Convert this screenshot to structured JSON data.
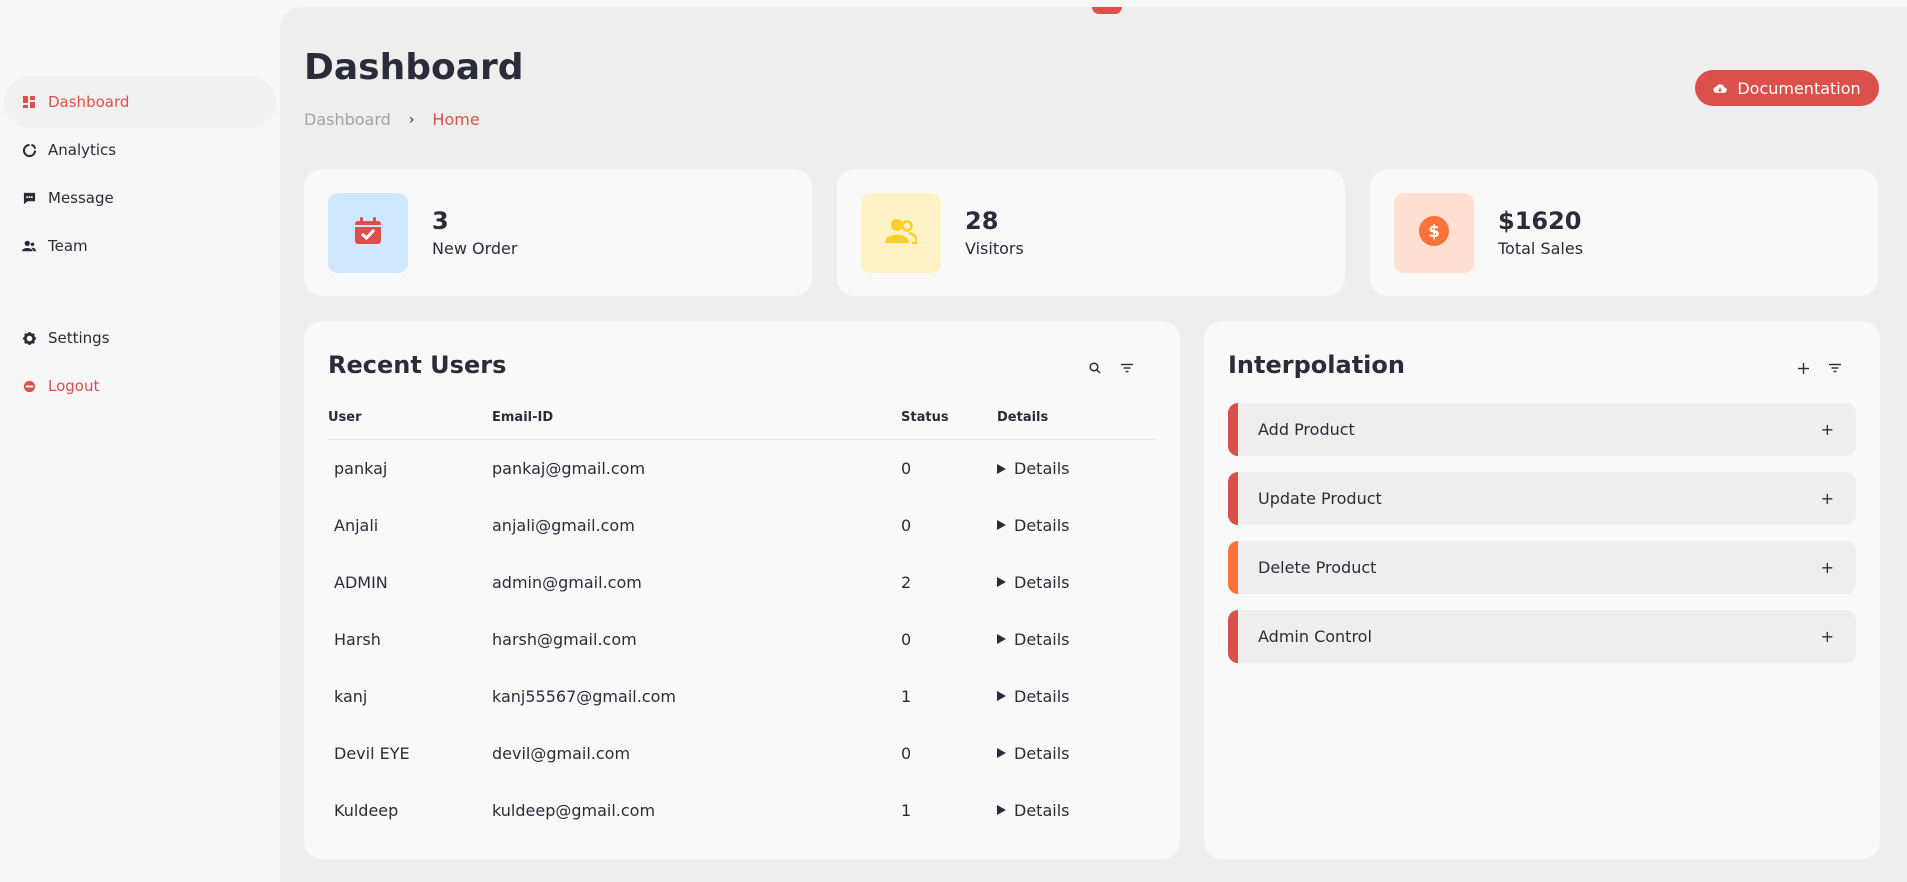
{
  "sidebar": {
    "items": [
      {
        "label": "Dashboard",
        "icon": "dashboard-icon",
        "active": true
      },
      {
        "label": "Analytics",
        "icon": "pie-chart-icon"
      },
      {
        "label": "Message",
        "icon": "message-icon"
      },
      {
        "label": "Team",
        "icon": "team-icon"
      },
      {
        "label": "Settings",
        "icon": "gear-icon"
      },
      {
        "label": "Logout",
        "icon": "logout-icon"
      }
    ]
  },
  "header": {
    "title": "Dashboard",
    "breadcrumb": [
      "Dashboard",
      "Home"
    ],
    "separator": "›",
    "doc_button": "Documentation"
  },
  "stats": [
    {
      "value": "3",
      "label": "New Order",
      "icon": "calendar-check-icon",
      "bg": "#cfe8ff",
      "fg": "#db504a"
    },
    {
      "value": "28",
      "label": "Visitors",
      "icon": "group-icon",
      "bg": "#fff2c6",
      "fg": "#ffce26"
    },
    {
      "value": "$1620",
      "label": "Total Sales",
      "icon": "dollar-circle-icon",
      "bg": "#ffe0d3",
      "fg": "#fd7238"
    }
  ],
  "recent_users": {
    "title": "Recent Users",
    "columns": [
      "User",
      "Email-ID",
      "Status",
      "Details"
    ],
    "details_label": "Details",
    "rows": [
      {
        "user": "pankaj",
        "email": "pankaj@gmail.com",
        "status": "0"
      },
      {
        "user": "Anjali",
        "email": "anjali@gmail.com",
        "status": "0"
      },
      {
        "user": "ADMIN",
        "email": "admin@gmail.com",
        "status": "2"
      },
      {
        "user": "Harsh",
        "email": "harsh@gmail.com",
        "status": "0"
      },
      {
        "user": "kanj",
        "email": "kanj55567@gmail.com",
        "status": "1"
      },
      {
        "user": "Devil EYE",
        "email": "devil@gmail.com",
        "status": "0"
      },
      {
        "user": "Kuldeep",
        "email": "kuldeep@gmail.com",
        "status": "1"
      }
    ]
  },
  "interpolation": {
    "title": "Interpolation",
    "plus": "+",
    "items": [
      {
        "label": "Add Product",
        "color": "#db504a"
      },
      {
        "label": "Update Product",
        "color": "#db504a"
      },
      {
        "label": "Delete Product",
        "color": "#fd7238"
      },
      {
        "label": "Admin Control",
        "color": "#db504a"
      }
    ]
  },
  "colors": {
    "accent": "#db504a",
    "orange": "#fd7238",
    "yellow": "#ffce26",
    "light": "#f9f9f9",
    "grey": "#eeeeee",
    "dark": "#2b2b3a"
  }
}
